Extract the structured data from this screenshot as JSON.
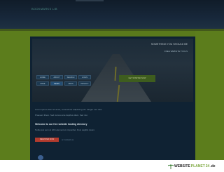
{
  "header": {
    "logo_text": "BOOKMARKS LIB",
    "top_line": ""
  },
  "hero": {
    "title": "SOMETHING YOU SHOULD BE",
    "subtitle": "FREE WEBSITE TOOLS",
    "buttons": [
      {
        "label": "HOME"
      },
      {
        "label": "ABOUT"
      },
      {
        "label": "SEARCH"
      },
      {
        "label": "LOGIN"
      },
      {
        "label": "FREE"
      },
      {
        "label": "NEWS"
      },
      {
        "label": "LINKS"
      },
      {
        "label": "PRIVACY"
      }
    ],
    "right_box": "GET STARTED NOW"
  },
  "content": {
    "paragraph1": "Lorem ipsum dolor sit amet, consectetur adipiscing elit. Integer nec odio.",
    "paragraph2": "Praesent libero. Sed cursus ante dapibus diam. Sed nisi.",
    "heading": "Welcome to our free website hosting directory",
    "paragraph3": "Nulla quis sem at nibh elementum imperdiet. Duis sagittis ipsum.",
    "red_button": "REGISTER NOW",
    "red_side_text": "or contact us",
    "badge_label": ""
  },
  "footer": {
    "brand_main": "WEBSITE",
    "brand_accent": "PLANET",
    "brand_tail": "24",
    "brand_suffix": ".de"
  },
  "colors": {
    "page_bg": "#5a7a1c",
    "panel_bg": "#0f2233",
    "header_bg": "#17273a",
    "accent_red": "#b33b2e"
  }
}
